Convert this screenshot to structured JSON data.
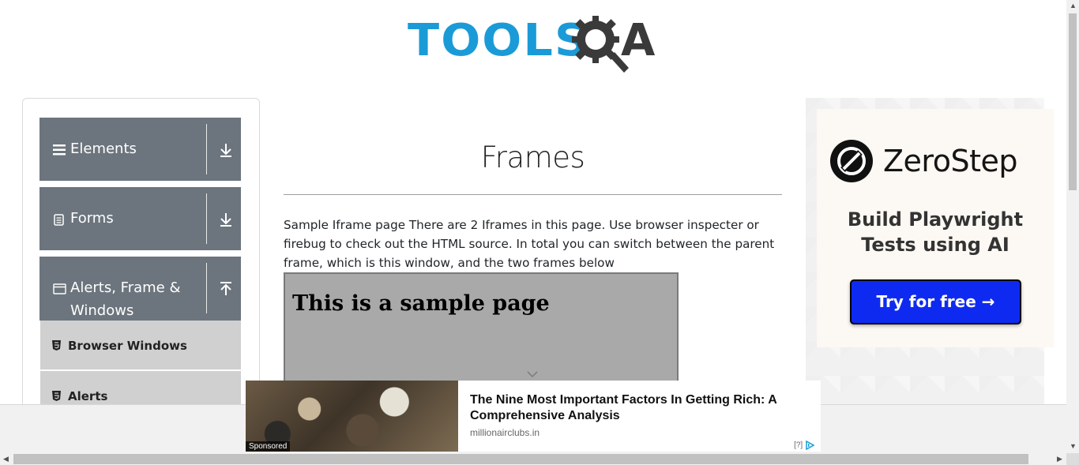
{
  "logo": {
    "text_tools": "TOOLS",
    "text_a": "A"
  },
  "sidebar": {
    "groups": [
      {
        "label": "Elements",
        "icon": "hamburger-icon",
        "expanded": false
      },
      {
        "label": "Forms",
        "icon": "form-icon",
        "expanded": false
      },
      {
        "label": "Alerts, Frame &",
        "label2": "Windows",
        "icon": "window-icon",
        "expanded": true
      }
    ],
    "sub_items": [
      {
        "label": "Browser Windows",
        "icon": "html5-icon"
      },
      {
        "label": "Alerts",
        "icon": "html5-icon"
      }
    ]
  },
  "main": {
    "title": "Frames",
    "description": "Sample Iframe page There are 2 Iframes in this page. Use browser inspecter or firebug to check out the HTML source. In total you can switch between the parent frame, which is this window, and the two frames below",
    "iframe_heading": "This is a sample page"
  },
  "ad_right": {
    "brand": "ZeroStep",
    "tagline_line1": "Build Playwright",
    "tagline_line2": "Tests using AI",
    "cta": "Try for free →"
  },
  "bottom_ad": {
    "sponsored": "Sponsored",
    "headline": "The Nine Most Important Factors In Getting Rich: A Comprehensive Analysis",
    "domain": "millionairclubs.in",
    "choices_label": "[?]"
  },
  "colors": {
    "group_bg": "#6c757d",
    "sub_bg": "#d0d0d0",
    "logo_blue": "#1a9bd7",
    "cta_blue": "#0f2af0"
  }
}
